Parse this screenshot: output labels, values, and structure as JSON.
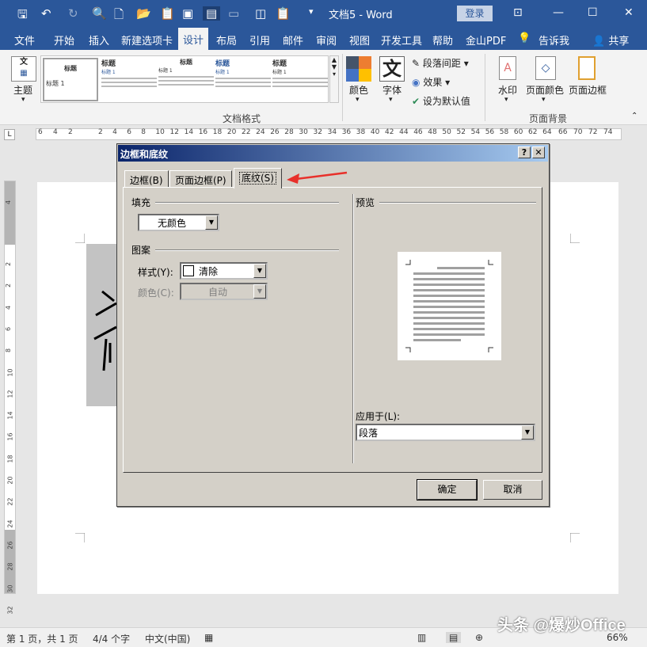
{
  "titlebar": {
    "doc_title": "文档5 - Word",
    "login": "登录"
  },
  "tabs": [
    "文件",
    "开始",
    "插入",
    "新建选项卡",
    "设计",
    "布局",
    "引用",
    "邮件",
    "审阅",
    "视图",
    "开发工具",
    "帮助",
    "金山PDF",
    "告诉我",
    "共享"
  ],
  "ribbon": {
    "theme_label": "主题",
    "gallery_thumbs": [
      {
        "title": "标题",
        "body": "标题 1"
      },
      {
        "title": "标题",
        "body": "标题 1"
      },
      {
        "title": "标题",
        "body": "标题 1"
      },
      {
        "title": "标题",
        "body": "标题 1"
      },
      {
        "title": "标题",
        "body": "标题 1"
      }
    ],
    "colors_label": "颜色",
    "fonts_label": "字体",
    "para_spacing_label": "段落间距",
    "effects_label": "效果",
    "set_default_label": "设为默认值",
    "group_doc_format": "文档格式",
    "watermark_label": "水印",
    "page_color_label": "页面颜色",
    "page_border_label": "页面边框",
    "group_page_bg": "页面背景"
  },
  "ruler": {
    "corner": "L",
    "numbers": [
      "6",
      "4",
      "2",
      "2",
      "4",
      "6",
      "8",
      "10",
      "12",
      "14",
      "16",
      "18",
      "20",
      "22",
      "24",
      "26",
      "28",
      "30",
      "32",
      "34",
      "36",
      "38",
      "40",
      "42",
      "44",
      "46",
      "48",
      "50",
      "52",
      "54",
      "56",
      "58",
      "60",
      "62",
      "64",
      "66",
      "70",
      "72",
      "74"
    ]
  },
  "vruler": {
    "numbers": [
      "4",
      "2",
      "2",
      "4",
      "6",
      "8",
      "10",
      "12",
      "14",
      "16",
      "18",
      "20",
      "22",
      "24",
      "26",
      "28",
      "30",
      "32"
    ]
  },
  "dialog": {
    "title": "边框和底纹",
    "help": "?",
    "close": "✕",
    "tabs": [
      "边框(B)",
      "页面边框(P)",
      "底纹(S)"
    ],
    "fill_title": "填充",
    "fill_value": "无颜色",
    "pattern_title": "图案",
    "style_label": "样式(Y):",
    "style_value": "清除",
    "color_label": "颜色(C):",
    "color_value": "自动",
    "preview_title": "预览",
    "apply_to_label": "应用于(L):",
    "apply_to_value": "段落",
    "ok": "确定",
    "cancel": "取消"
  },
  "status": {
    "page": "第 1 页，共 1 页",
    "words": "4/4 个字",
    "lang": "中文(中国)",
    "zoom": "66%"
  },
  "watermark_text": "头条 @爆炒Office",
  "colors": {
    "word_blue": "#2b579a",
    "dialog_bg": "#d4d0c8",
    "arrow_red": "#e8302a"
  }
}
